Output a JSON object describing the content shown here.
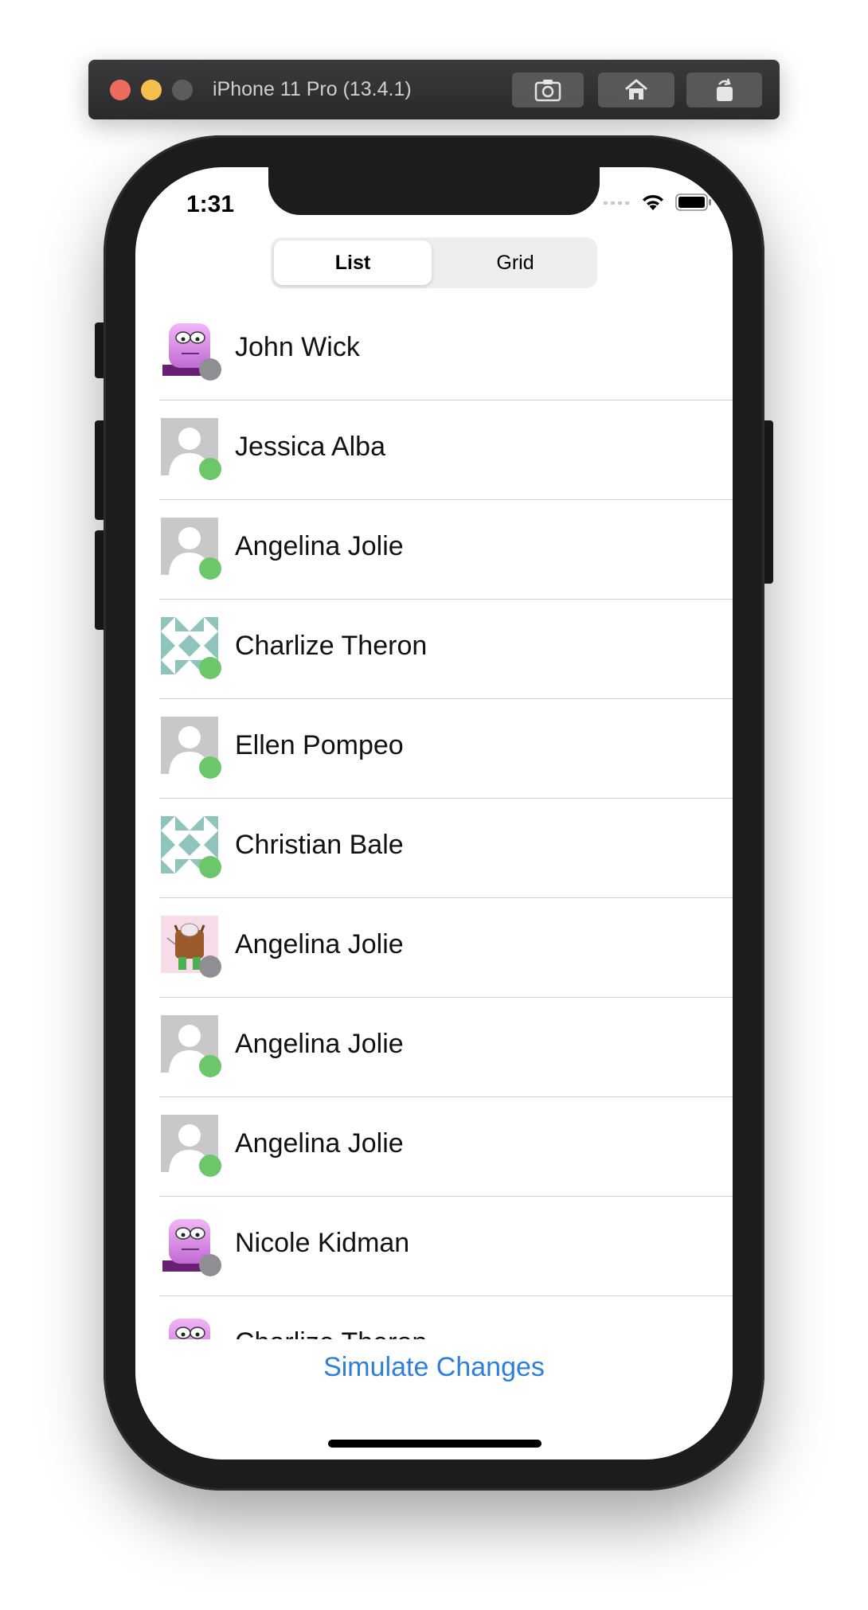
{
  "simulator": {
    "title": "iPhone 11 Pro (13.4.1)",
    "buttons": [
      "screenshot-icon",
      "home-icon",
      "rotate-icon"
    ]
  },
  "status_bar": {
    "time": "1:31",
    "icons": [
      "signal-icon",
      "wifi-icon",
      "battery-icon"
    ]
  },
  "segmented": {
    "options": [
      "List",
      "Grid"
    ],
    "selected": "List"
  },
  "colors": {
    "online": "#6cc66a",
    "offline": "#8e8e93",
    "accent": "#2e7fdd"
  },
  "contacts": [
    {
      "name": "John Wick",
      "avatar": "purple-monster",
      "status": "offline"
    },
    {
      "name": "Jessica Alba",
      "avatar": "placeholder",
      "status": "online"
    },
    {
      "name": "Angelina Jolie",
      "avatar": "placeholder",
      "status": "online"
    },
    {
      "name": "Charlize Theron",
      "avatar": "teal-pattern",
      "status": "online"
    },
    {
      "name": "Ellen Pompeo",
      "avatar": "placeholder",
      "status": "online"
    },
    {
      "name": "Christian Bale",
      "avatar": "teal-pattern",
      "status": "online"
    },
    {
      "name": "Angelina Jolie",
      "avatar": "brown-monster",
      "status": "offline"
    },
    {
      "name": "Angelina Jolie",
      "avatar": "placeholder",
      "status": "online"
    },
    {
      "name": "Angelina Jolie",
      "avatar": "placeholder",
      "status": "online"
    },
    {
      "name": "Nicole Kidman",
      "avatar": "purple-monster",
      "status": "offline"
    },
    {
      "name": "Charlize Theron",
      "avatar": "purple-monster",
      "status": "online"
    }
  ],
  "footer": {
    "action_label": "Simulate Changes"
  }
}
